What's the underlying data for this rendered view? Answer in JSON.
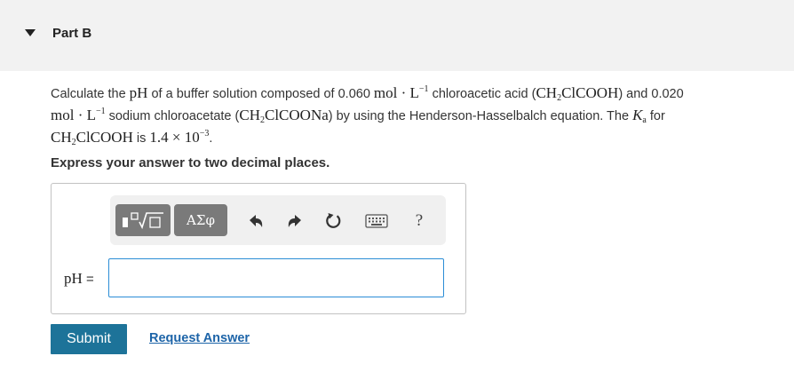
{
  "header": {
    "title": "Part B"
  },
  "problem": {
    "t1": "Calculate the",
    "ph": "pH",
    "t2": "of a buffer solution composed of 0.060",
    "unit": "mol · L",
    "exp": "−1",
    "t3": "chloroacetic acid (",
    "acid_a": "CH",
    "acid_sub": "2",
    "acid_b": "ClCOOH",
    "t4": ") and 0.020",
    "t5": "sodium chloroacetate (",
    "salt_a": "CH",
    "salt_sub": "2",
    "salt_b": "ClCOONa",
    "t6": ") by using the Henderson-Hasselbalch equation. The",
    "ka": "K",
    "ka_sub": "a",
    "t7": "for",
    "t8": "is",
    "ka_value": "1.4 × 10",
    "ka_exp": "−3",
    "end": "."
  },
  "instruction": "Express your answer to two decimal places.",
  "toolbar": {
    "symbols_label": "ΑΣφ",
    "help_label": "?",
    "icons": [
      "template-icon",
      "undo-icon",
      "redo-icon",
      "reset-icon",
      "keyboard-icon",
      "help-icon"
    ]
  },
  "answer": {
    "label_var": "pH",
    "label_eq": " =",
    "value": ""
  },
  "buttons": {
    "submit": "Submit",
    "request": "Request Answer"
  },
  "colors": {
    "header_bg": "#f2f2f2",
    "submit_bg": "#1d7399",
    "link": "#1d64a8",
    "input_border": "#2b8dd6",
    "tool_btn": "#7a7a7a"
  }
}
